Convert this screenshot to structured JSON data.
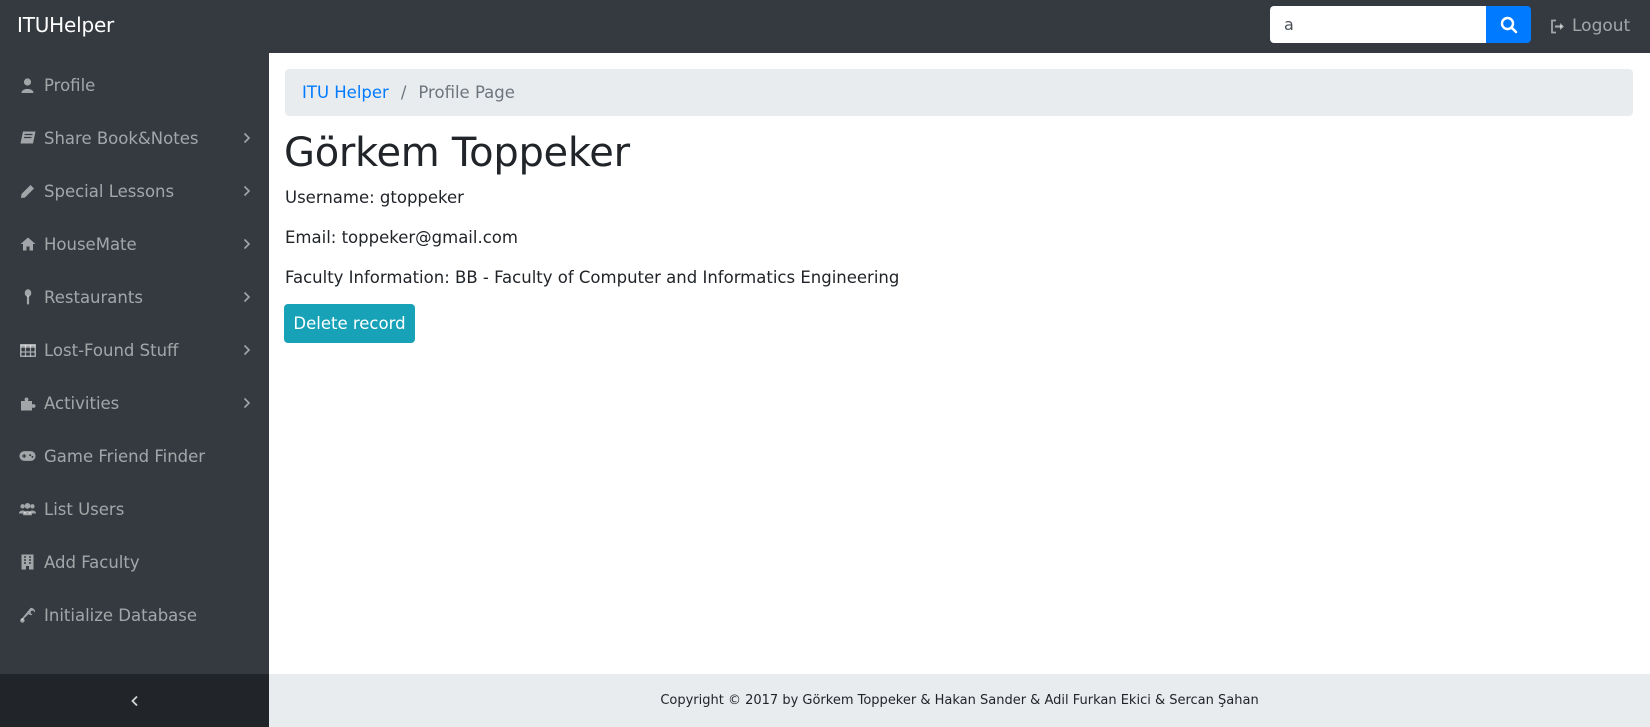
{
  "header": {
    "brand": "ITUHelper",
    "search_value": "a",
    "logout_label": "Logout"
  },
  "sidebar": {
    "items": [
      {
        "label": "Profile",
        "icon": "user-icon",
        "expandable": false
      },
      {
        "label": "Share Book&Notes",
        "icon": "book-icon",
        "expandable": true
      },
      {
        "label": "Special Lessons",
        "icon": "pencil-icon",
        "expandable": true
      },
      {
        "label": "HouseMate",
        "icon": "home-icon",
        "expandable": true
      },
      {
        "label": "Restaurants",
        "icon": "spoon-icon",
        "expandable": true
      },
      {
        "label": "Lost-Found Stuff",
        "icon": "table-icon",
        "expandable": true
      },
      {
        "label": "Activities",
        "icon": "puzzle-icon",
        "expandable": true
      },
      {
        "label": "Game Friend Finder",
        "icon": "gamepad-icon",
        "expandable": false
      },
      {
        "label": "List Users",
        "icon": "users-icon",
        "expandable": false
      },
      {
        "label": "Add Faculty",
        "icon": "building-icon",
        "expandable": false
      },
      {
        "label": "Initialize Database",
        "icon": "wrench-icon",
        "expandable": false
      }
    ]
  },
  "breadcrumb": {
    "home": "ITU Helper",
    "separator": "/",
    "current": "Profile Page"
  },
  "profile": {
    "name": "Görkem Toppeker",
    "username": "Username: gtoppeker",
    "email": "Email: toppeker@gmail.com",
    "faculty": "Faculty Information: BB - Faculty of Computer and Informatics Engineering",
    "delete_label": "Delete record"
  },
  "footer": {
    "text": "Copyright © 2017 by Görkem Toppeker & Hakan Sander & Adil Furkan Ekici & Sercan Şahan"
  },
  "colors": {
    "navbar": "#343a40",
    "primary": "#007bff",
    "info": "#17a2b8",
    "breadcrumb_bg": "#e9ecef"
  }
}
